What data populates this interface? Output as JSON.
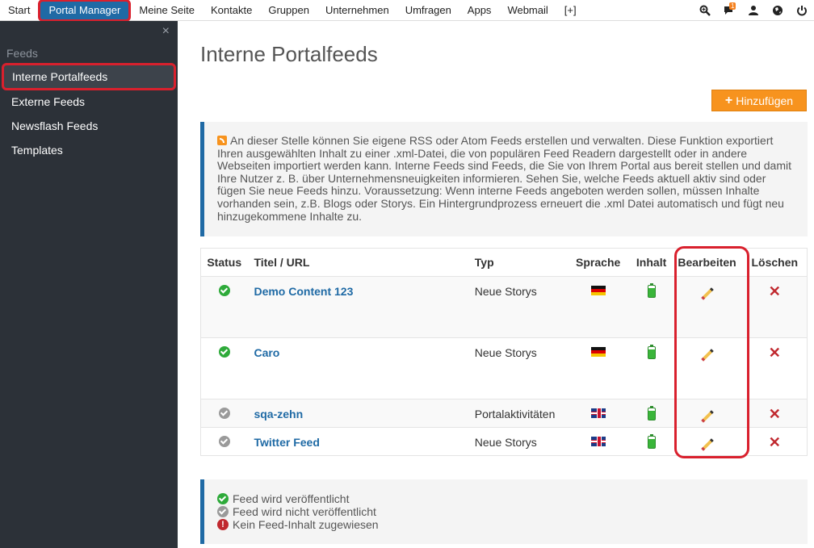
{
  "topnav": {
    "items": [
      "Start",
      "Portal Manager",
      "Meine Seite",
      "Kontakte",
      "Gruppen",
      "Unternehmen",
      "Umfragen",
      "Apps",
      "Webmail",
      "[+]"
    ],
    "active_index": 1,
    "notification_count": "1",
    "icons": [
      "search-zoom-icon",
      "chat-icon",
      "user-icon",
      "globe-icon",
      "power-icon"
    ]
  },
  "sidebar": {
    "header": "Feeds",
    "close": "×",
    "items": [
      "Interne Portalfeeds",
      "Externe Feeds",
      "Newsflash Feeds",
      "Templates"
    ],
    "active_index": 0
  },
  "main": {
    "title": "Interne Portalfeeds",
    "add_button": "Hinzufügen",
    "info_text": "An dieser Stelle können Sie eigene RSS oder Atom Feeds erstellen und verwalten. Diese Funktion exportiert Ihren ausgewählten Inhalt zu einer .xml-Datei, die von populären Feed Readern dargestellt oder in andere Webseiten importiert werden kann. Interne Feeds sind Feeds, die Sie von Ihrem Portal aus bereit stellen und damit Ihre Nutzer z. B. über Unternehmensneuigkeiten informieren. Sehen Sie, welche Feeds aktuell aktiv sind oder fügen Sie neue Feeds hinzu. Voraussetzung: Wenn interne Feeds angeboten werden sollen, müssen Inhalte vorhanden sein, z.B. Blogs oder Storys. Ein Hintergrundprozess erneuert die .xml Datei automatisch und fügt neu hinzugekommene Inhalte zu."
  },
  "table": {
    "headers": [
      "Status",
      "Titel / URL",
      "Typ",
      "Sprache",
      "Inhalt",
      "Bearbeiten",
      "Löschen"
    ],
    "rows": [
      {
        "status": "published",
        "title": "Demo Content 123",
        "type": "Neue Storys",
        "language": "de"
      },
      {
        "status": "published",
        "title": "Caro",
        "type": "Neue Storys",
        "language": "de"
      },
      {
        "status": "unpublished",
        "title": "sqa-zehn",
        "type": "Portalaktivitäten",
        "language": "en"
      },
      {
        "status": "unpublished",
        "title": "Twitter Feed",
        "type": "Neue Storys",
        "language": "en"
      }
    ]
  },
  "legend": {
    "items": [
      "Feed wird veröffentlicht",
      "Feed wird nicht veröffentlicht",
      "Kein Feed-Inhalt zugewiesen"
    ]
  },
  "colors": {
    "accent": "#1f6aa5",
    "highlight": "#d9202d",
    "button": "#f7931e",
    "sidebar_bg": "#2c3138"
  }
}
